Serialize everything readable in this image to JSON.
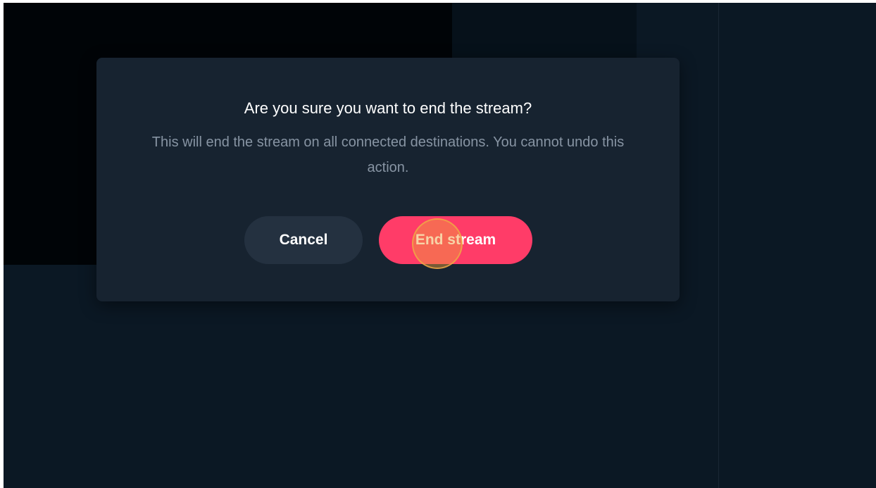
{
  "dialog": {
    "title": "Are you sure you want to end the stream?",
    "description": "This will end the stream on all connected destinations. You cannot undo this action.",
    "cancel_label": "Cancel",
    "confirm_label": "End stream"
  },
  "colors": {
    "background": "#0b1824",
    "modal": "#172330",
    "cancel_button": "#243140",
    "confirm_button": "#ff3c68"
  }
}
